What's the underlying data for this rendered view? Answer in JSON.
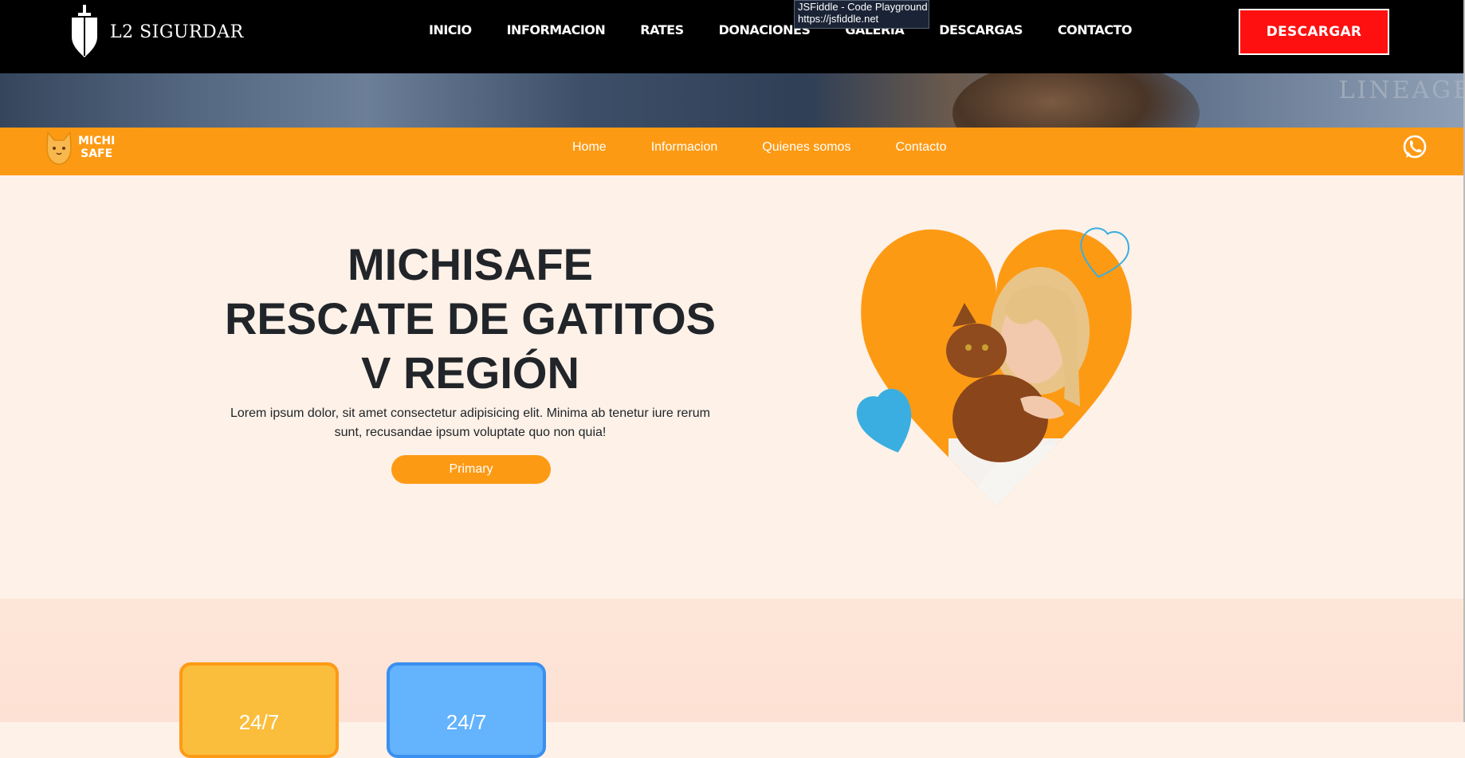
{
  "tooltip": {
    "line1": "JSFiddle - Code Playground",
    "line2": "https://jsfiddle.net"
  },
  "topbar": {
    "logo_text": "L2 SIGURDAR",
    "nav": [
      "INICIO",
      "INFORMACION",
      "RATES",
      "DONACIONES",
      "GALERIA",
      "DESCARGAS",
      "CONTACTO"
    ],
    "download_label": "DESCARGAR"
  },
  "banner": {
    "watermark": "LINEAGE"
  },
  "orangebar": {
    "logo_line1": "MICHI",
    "logo_line2": "SAFE",
    "nav": [
      "Home",
      "Informacion",
      "Quienes somos",
      "Contacto"
    ],
    "whatsapp_icon": "whatsapp-icon"
  },
  "hero": {
    "title_lines": [
      "MICHISAFE",
      "RESCATE DE GATITOS",
      "V REGIÓN"
    ],
    "text": "Lorem ipsum dolor, sit amet consectetur adipisicing elit. Minima ab tenetur iure rerum sunt, recusandae ipsum voluptate quo non quia!",
    "button_label": "Primary"
  },
  "cards": [
    {
      "label": "24/7"
    },
    {
      "label": "24/7"
    }
  ],
  "colors": {
    "orange": "#fd9a14",
    "download_red": "#ff1010",
    "card_blue": "#63b3fd",
    "card_yellow": "#fbbd3c",
    "heart_blue": "#3aaee0"
  }
}
